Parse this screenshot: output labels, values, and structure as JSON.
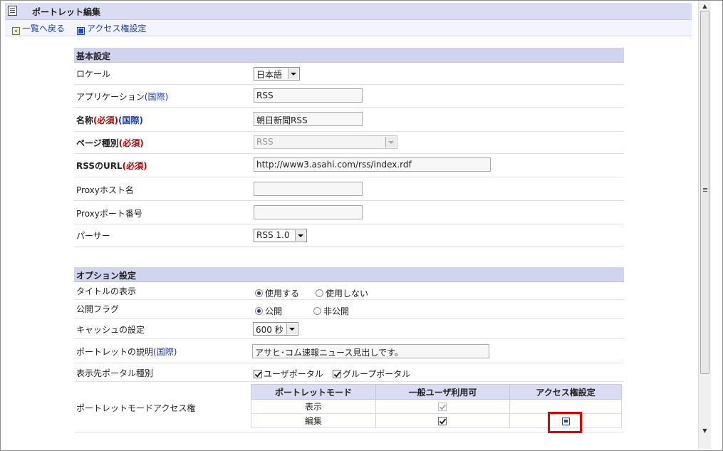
{
  "header": {
    "title": "ポートレット編集"
  },
  "nav": {
    "back": "一覧へ戻る",
    "acl": "アクセス権設定"
  },
  "basic": {
    "title": "基本設定",
    "locale": {
      "label": "ロケール",
      "value": "日本語"
    },
    "app": {
      "label": "アプリケーション",
      "intl": "(国際)",
      "value": "RSS"
    },
    "name": {
      "label": "名称",
      "req": "(必須)",
      "intl": "(国際)",
      "value": "朝日新聞RSS"
    },
    "page_type": {
      "label": "ページ種別",
      "req": "(必須)",
      "value": "RSS"
    },
    "rss_url": {
      "label": "RSSのURL",
      "req": "(必須)",
      "value": "http://www3.asahi.com/rss/index.rdf"
    },
    "proxy_host": {
      "label": "Proxyホスト名",
      "value": ""
    },
    "proxy_port": {
      "label": "Proxyポート番号",
      "value": ""
    },
    "parser": {
      "label": "パーサー",
      "value": "RSS 1.0"
    }
  },
  "options": {
    "title": "オプション設定",
    "title_display": {
      "label": "タイトルの表示",
      "opt1": "使用する",
      "opt2": "使用しない"
    },
    "public_flag": {
      "label": "公開フラグ",
      "opt1": "公開",
      "opt2": "非公開"
    },
    "cache": {
      "label": "キャッシュの設定",
      "value": "600 秒"
    },
    "description": {
      "label": "ポートレットの説明",
      "intl": "(国際)",
      "value": "アサヒ･コム速報ニュース見出しです。"
    },
    "portal_type": {
      "label": "表示先ポータル種別",
      "opt1": "ユーザポータル",
      "opt2": "グループポータル"
    },
    "mode_acl": {
      "label": "ポートレットモードアクセス権",
      "headers": [
        "ポートレットモード",
        "一般ユーザ利用可",
        "アクセス権設定"
      ],
      "rows": [
        {
          "mode": "表示"
        },
        {
          "mode": "編集"
        }
      ]
    }
  }
}
